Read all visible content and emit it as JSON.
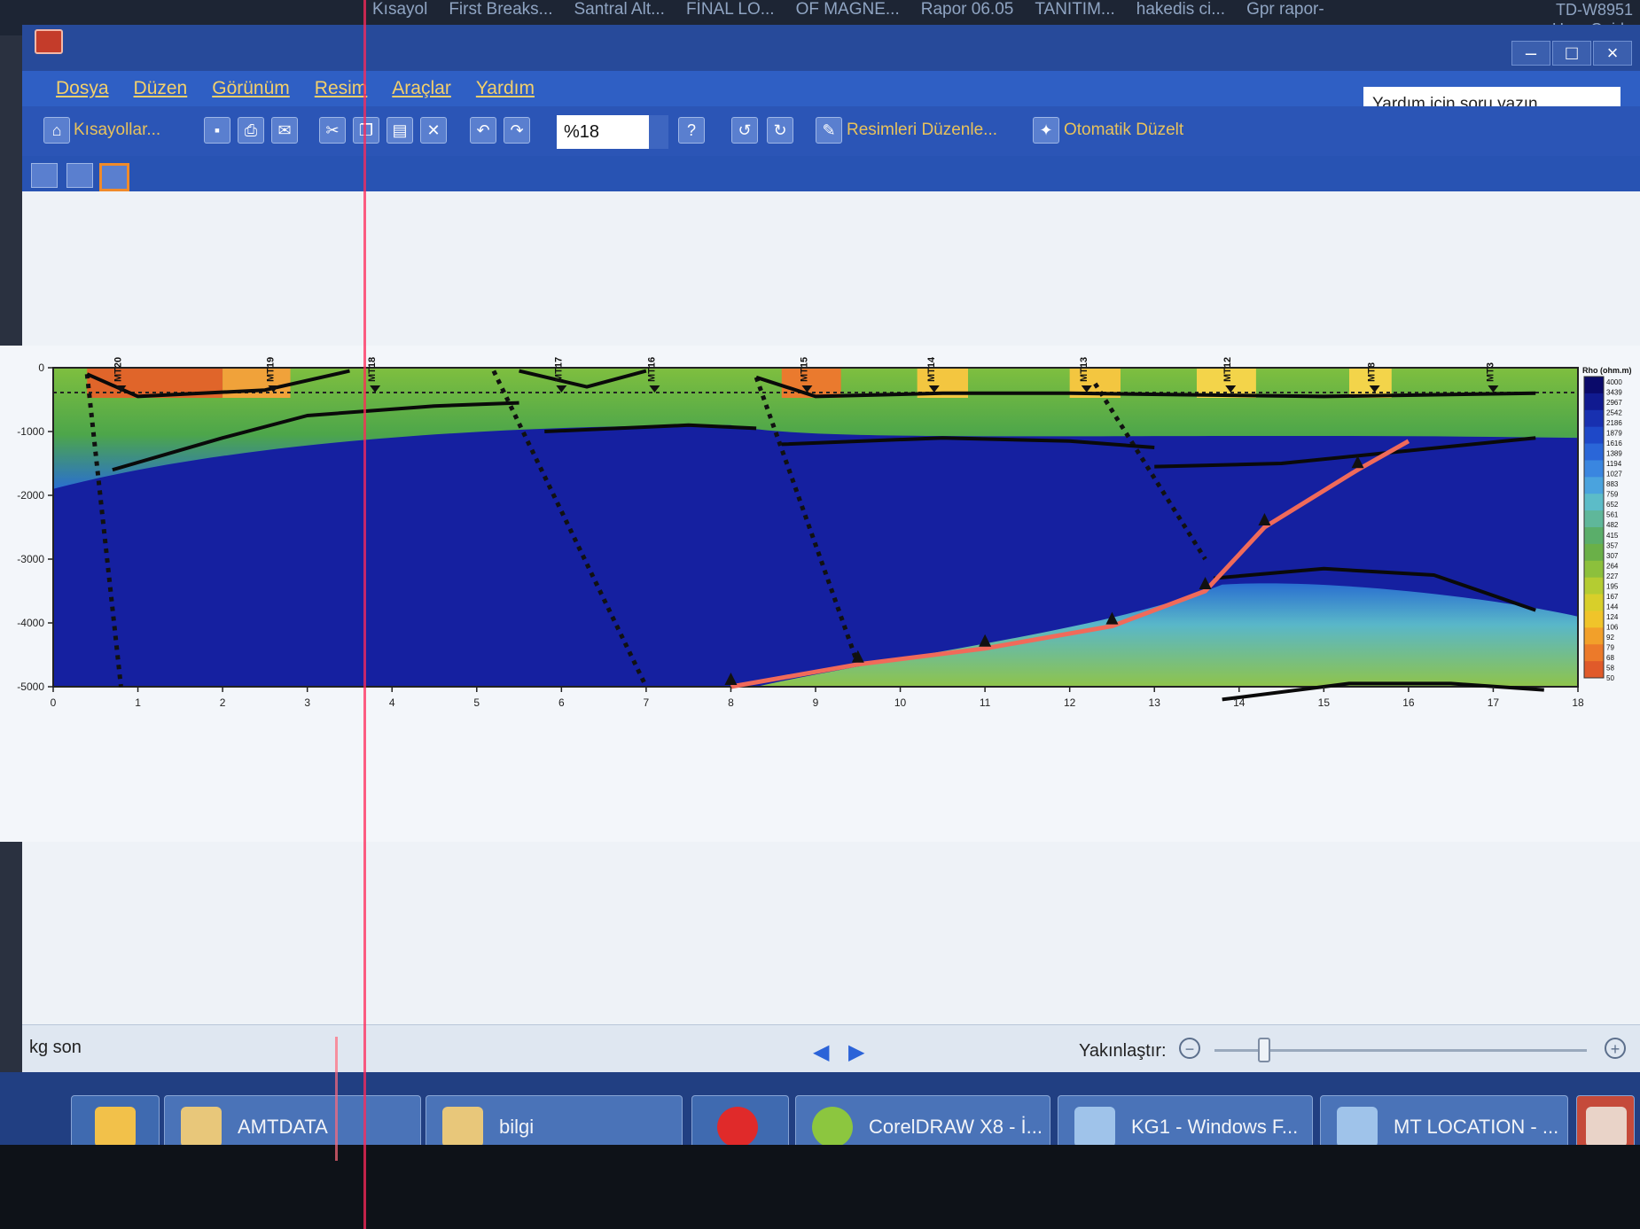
{
  "desktop": {
    "shortcuts": [
      "Kısayol",
      "First Breaks...",
      "Santral Alt...",
      "FİNAL LO...",
      "OF MAGNE...",
      "Rapor 06.05",
      "TANITIM...",
      "hakedis ci...",
      "Gpr rapor-"
    ],
    "corner_text": [
      "TD-W8951",
      "User Guide"
    ]
  },
  "menu": [
    "Dosya",
    "Düzen",
    "Görünüm",
    "Resim",
    "Araçlar",
    "Yardım"
  ],
  "help_placeholder": "Yardım için soru yazın",
  "toolbar": {
    "shortcuts_label": "Kısayollar...",
    "zoom_value": "%18",
    "help_symbol": "?",
    "edit_images_label": "Resimleri Düzenle...",
    "auto_fix_label": "Otomatik Düzelt"
  },
  "status": {
    "filename": "kg son",
    "zoom_label": "Yakınlaştır:"
  },
  "taskbar": {
    "items": [
      "AMTDATA",
      "bilgi",
      "CorelDRAW X8 - İ...",
      "KG1 - Windows F...",
      "MT LOCATION - ..."
    ]
  },
  "chart_data": {
    "type": "heatmap",
    "title": "",
    "stations": [
      "MT20",
      "MT19",
      "MT18",
      "MT17",
      "MT16",
      "MT15",
      "MT14",
      "MT13",
      "MT12",
      "MT8",
      "MT3"
    ],
    "station_x": [
      0.8,
      2.6,
      3.8,
      6.0,
      7.1,
      8.9,
      10.4,
      12.2,
      13.9,
      15.6,
      17.0
    ],
    "x_ticks": [
      "0",
      "1",
      "2",
      "3",
      "4",
      "5",
      "6",
      "7",
      "8",
      "9",
      "10",
      "11",
      "12",
      "13",
      "14",
      "15",
      "16",
      "17",
      "18"
    ],
    "xlim": [
      0,
      18
    ],
    "y_ticks": [
      "0",
      "-1000",
      "-2000",
      "-3000",
      "-4000",
      "-5000"
    ],
    "ylim": [
      -5000,
      0
    ],
    "colorbar_title": "Rho (ohm.m)",
    "colorbar_labels": [
      "4000",
      "3439",
      "2967",
      "2542",
      "2186",
      "1879",
      "1616",
      "1389",
      "1194",
      "1027",
      "883",
      "759",
      "652",
      "561",
      "482",
      "415",
      "357",
      "307",
      "264",
      "227",
      "195",
      "167",
      "144",
      "124",
      "106",
      "92",
      "79",
      "68",
      "58",
      "50"
    ],
    "red_line": [
      [
        8.0,
        -5000
      ],
      [
        9.5,
        -4650
      ],
      [
        11.0,
        -4400
      ],
      [
        12.5,
        -4050
      ],
      [
        13.6,
        -3500
      ],
      [
        14.3,
        -2500
      ],
      [
        15.4,
        -1600
      ],
      [
        16.0,
        -1150
      ]
    ],
    "black_lines": [
      [
        [
          0.4,
          -100
        ],
        [
          1.0,
          -450
        ],
        [
          2.5,
          -350
        ],
        [
          3.5,
          -50
        ]
      ],
      [
        [
          0.7,
          -1600
        ],
        [
          2.0,
          -1100
        ],
        [
          3.0,
          -750
        ],
        [
          4.5,
          -600
        ],
        [
          5.5,
          -550
        ]
      ],
      [
        [
          5.5,
          -50
        ],
        [
          6.3,
          -300
        ],
        [
          7.0,
          -50
        ]
      ],
      [
        [
          5.8,
          -1000
        ],
        [
          7.5,
          -900
        ],
        [
          8.3,
          -950
        ]
      ],
      [
        [
          8.3,
          -150
        ],
        [
          9.0,
          -450
        ],
        [
          10.5,
          -400
        ],
        [
          12.0,
          -400
        ],
        [
          15.0,
          -450
        ],
        [
          17.5,
          -400
        ]
      ],
      [
        [
          8.6,
          -1200
        ],
        [
          10.5,
          -1100
        ],
        [
          12.0,
          -1150
        ],
        [
          13.0,
          -1250
        ]
      ],
      [
        [
          13.0,
          -1550
        ],
        [
          14.5,
          -1500
        ],
        [
          16.0,
          -1300
        ],
        [
          17.5,
          -1100
        ]
      ],
      [
        [
          13.7,
          -3300
        ],
        [
          15.0,
          -3150
        ],
        [
          16.3,
          -3250
        ],
        [
          17.5,
          -3800
        ]
      ],
      [
        [
          13.8,
          -5200
        ],
        [
          15.3,
          -4950
        ],
        [
          16.5,
          -4950
        ],
        [
          17.6,
          -5050
        ]
      ]
    ],
    "dotted_faults": [
      [
        [
          0.4,
          -100
        ],
        [
          0.8,
          -5000
        ]
      ],
      [
        [
          5.2,
          -50
        ],
        [
          7.0,
          -5000
        ]
      ],
      [
        [
          8.3,
          -150
        ],
        [
          9.5,
          -4650
        ]
      ],
      [
        [
          12.3,
          -250
        ],
        [
          13.6,
          -3000
        ]
      ]
    ]
  }
}
